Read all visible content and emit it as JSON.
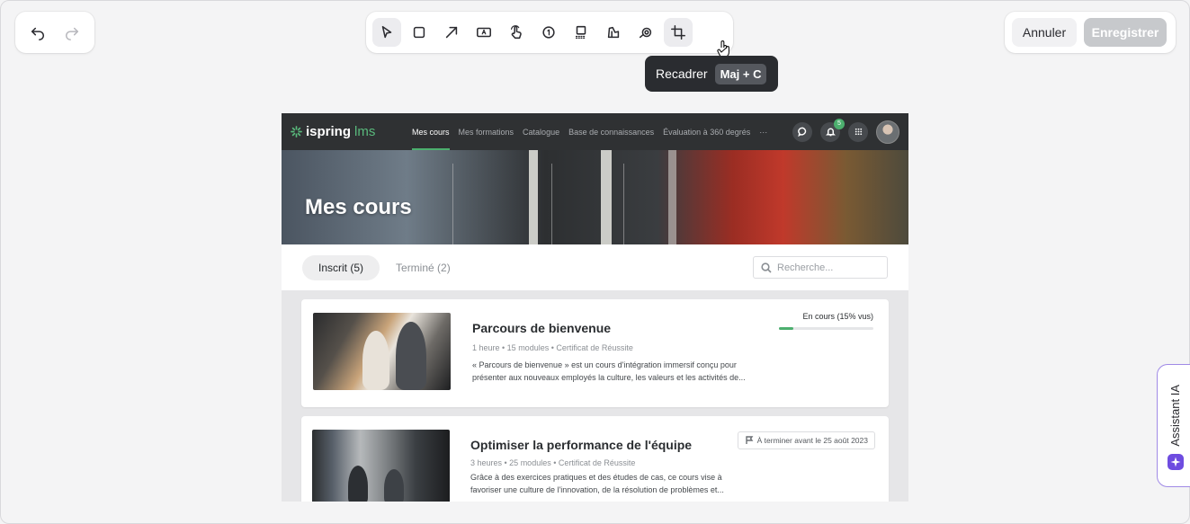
{
  "editor": {
    "tooltip": {
      "label": "Recadrer",
      "shortcut": "Maj + C"
    },
    "actions": {
      "cancel_label": "Annuler",
      "save_label": "Enregistrer"
    },
    "tools": [
      {
        "name": "select-tool",
        "icon": "cursor-arrow-icon"
      },
      {
        "name": "rectangle-tool",
        "icon": "square-icon"
      },
      {
        "name": "arrow-tool",
        "icon": "arrow-up-right-icon"
      },
      {
        "name": "text-tool",
        "icon": "text-box-icon"
      },
      {
        "name": "click-tool",
        "icon": "hand-pointer-icon"
      },
      {
        "name": "step-number-tool",
        "icon": "number-circle-icon"
      },
      {
        "name": "blur-tool",
        "icon": "blur-grid-icon"
      },
      {
        "name": "highlight-tool",
        "icon": "marker-icon"
      },
      {
        "name": "magnify-tool",
        "icon": "magnifier-icon"
      },
      {
        "name": "crop-tool",
        "icon": "crop-icon"
      }
    ],
    "assistant_label": "Assistant IA"
  },
  "lms": {
    "logo": {
      "brand": "ispring",
      "product": "lms"
    },
    "nav": [
      "Mes cours",
      "Mes formations",
      "Catalogue",
      "Base de connaissances",
      "Évaluation à 360 degrés",
      "···"
    ],
    "notification_count": "5",
    "hero_title": "Mes cours",
    "tabs": {
      "enrolled": "Inscrit (5)",
      "completed": "Terminé (2)"
    },
    "search_placeholder": "Recherche...",
    "courses": [
      {
        "title": "Parcours de bienvenue",
        "meta": "1 heure  •  15 modules  •  Certificat de Réussite",
        "description": "« Parcours de bienvenue » est un cours d'intégration immersif conçu pour présenter aux nouveaux employés la culture, les valeurs et les activités de...",
        "status": "En cours (15% vus)",
        "progress": 0.15
      },
      {
        "title": "Optimiser la performance de l'équipe",
        "meta": "3 heures  •  25 modules  •  Certificat de Réussite",
        "description": "Grâce à des exercices pratiques et des études de cas, ce cours vise à favoriser une culture de l'innovation, de la résolution de problèmes et...",
        "deadline": "À terminer avant le 25 août 2023"
      }
    ]
  },
  "colors": {
    "accent_green": "#4caf6e",
    "ai_purple": "#6e4ce0",
    "nav_dark": "#2f3133"
  }
}
